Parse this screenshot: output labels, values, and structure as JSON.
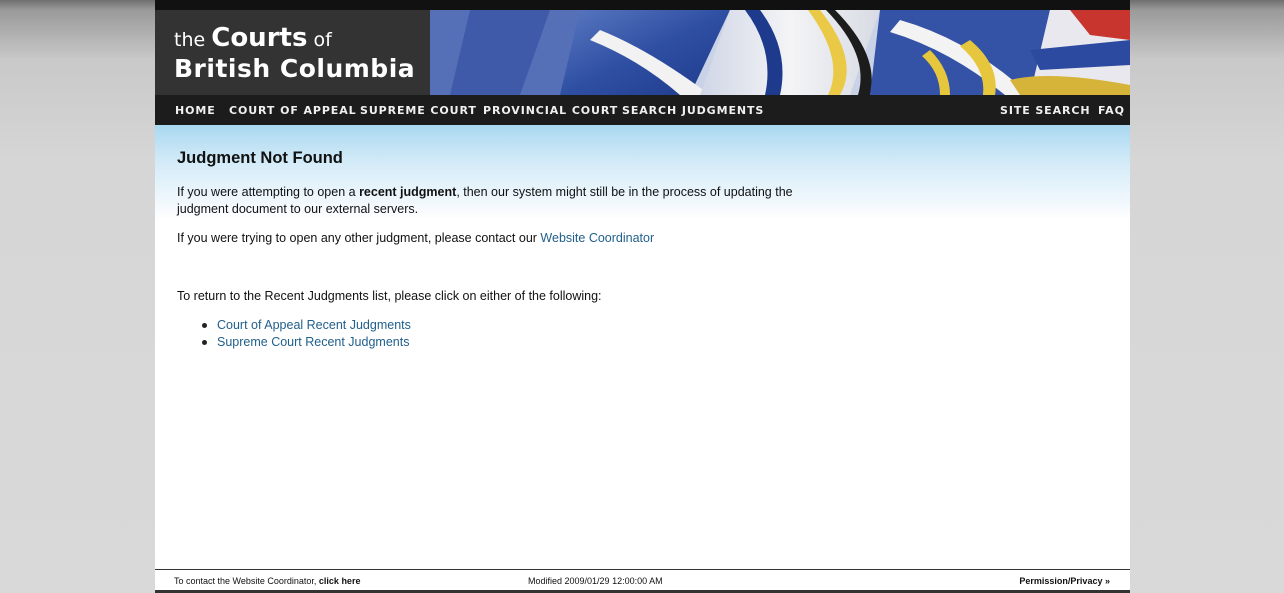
{
  "header": {
    "logo_the": "the",
    "logo_courts": "Courts",
    "logo_of": "of",
    "logo_line2": "British Columbia"
  },
  "nav": {
    "home": "HOME",
    "court_of_appeal": "COURT OF APPEAL",
    "supreme_court": "SUPREME COURT",
    "provincial_court": "PROVINCIAL COURT",
    "search_judgments": "SEARCH JUDGMENTS",
    "site_search": "SITE SEARCH",
    "faq": "FAQ"
  },
  "main": {
    "title": "Judgment Not Found",
    "p1_pre": "If you were attempting to open a ",
    "p1_bold": "recent judgment",
    "p1_post": ", then our system might still be in the process of updating the judgment document to our external servers.",
    "p2_pre": "If you were trying to open any other judgment, please contact our ",
    "p2_link": "Website Coordinator",
    "p3": "To return to the Recent Judgments list, please click on either of the following:",
    "links": [
      "Court of Appeal Recent Judgments",
      "Supreme Court Recent Judgments"
    ]
  },
  "footer": {
    "contact_pre": "To contact the Website Coordinator, ",
    "contact_link": "click here",
    "modified": "Modified 2009/01/29 12:00:00 AM",
    "permission": "Permission/Privacy",
    "permission_arrow": "»"
  },
  "colors": {
    "link": "#1f5f8b",
    "nav_bg": "#1c1c1c",
    "header_bg": "#333333"
  }
}
